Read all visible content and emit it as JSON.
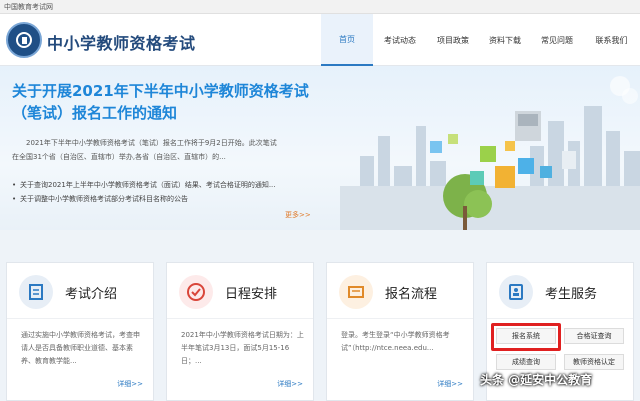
{
  "top_strip": {
    "text": "中国教育考试网"
  },
  "header": {
    "site_title": "中小学教师资格考试"
  },
  "nav": [
    {
      "label": "首页",
      "active": true
    },
    {
      "label": "考试动态"
    },
    {
      "label": "项目政策"
    },
    {
      "label": "资料下载"
    },
    {
      "label": "常见问题"
    },
    {
      "label": "联系我们"
    }
  ],
  "banner": {
    "title": "关于开展2021年下半年中小学教师资格考试（笔试）报名工作的通知",
    "body": "2021年下半年中小学教师资格考试（笔试）报名工作将于9月2日开始。此次笔试在全国31个省（自治区、直辖市）举办,各省（自治区、直辖市）的...",
    "list": [
      "关于查询2021年上半年中小学教师资格考试（面试）结果、考试合格证明的通知...",
      "关于调整中小学教师资格考试部分考试科目名称的公告"
    ],
    "more": "更多>>"
  },
  "cards": [
    {
      "title": "考试介绍",
      "text": "通过实施中小学教师资格考试，考查申请人是否具备教师职业道德、基本素养、教育教学能...",
      "more": "详细>>",
      "icon": "document-icon"
    },
    {
      "title": "日程安排",
      "text": "2021年中小学教师资格考试日期为：上半年笔试3月13日，面试5月15-16日；...",
      "more": "详细>>",
      "icon": "check-icon"
    },
    {
      "title": "报名流程",
      "text": "登录。考生登录“中小学教师资格考试”（http://ntce.neea.edu...",
      "more": "详细>>",
      "icon": "form-icon"
    },
    {
      "title": "考生服务",
      "icon": "id-card-icon",
      "buttons": [
        "报名系统",
        "合格证查询",
        "成绩查询",
        "教师资格认定"
      ]
    }
  ],
  "watermark": "头条 @延安中公教育",
  "colors": {
    "accent": "#2b79c2",
    "title_blue": "#1e86d8",
    "highlight": "#e02020",
    "more_orange": "#e07a2a"
  }
}
